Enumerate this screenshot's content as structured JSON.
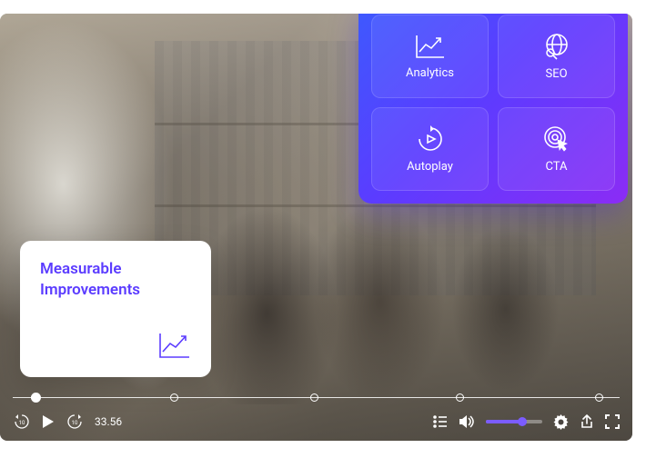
{
  "overlay_card": {
    "title": "Measurable Improvements"
  },
  "features": {
    "tiles": [
      {
        "label": "Analytics",
        "icon": "analytics-icon"
      },
      {
        "label": "SEO",
        "icon": "seo-icon"
      },
      {
        "label": "Autoplay",
        "icon": "autoplay-icon"
      },
      {
        "label": "CTA",
        "icon": "cta-icon"
      }
    ]
  },
  "player": {
    "timestamp": "33.56",
    "progress_percent": 3,
    "markers_percent": [
      3,
      26,
      49,
      73,
      96
    ],
    "volume_percent": 60
  },
  "colors": {
    "accent": "#5B3CFF",
    "panel_gradient_start": "#3D5AFE",
    "panel_gradient_end": "#8B2CF5",
    "volume_fill": "#7B5CFF"
  }
}
